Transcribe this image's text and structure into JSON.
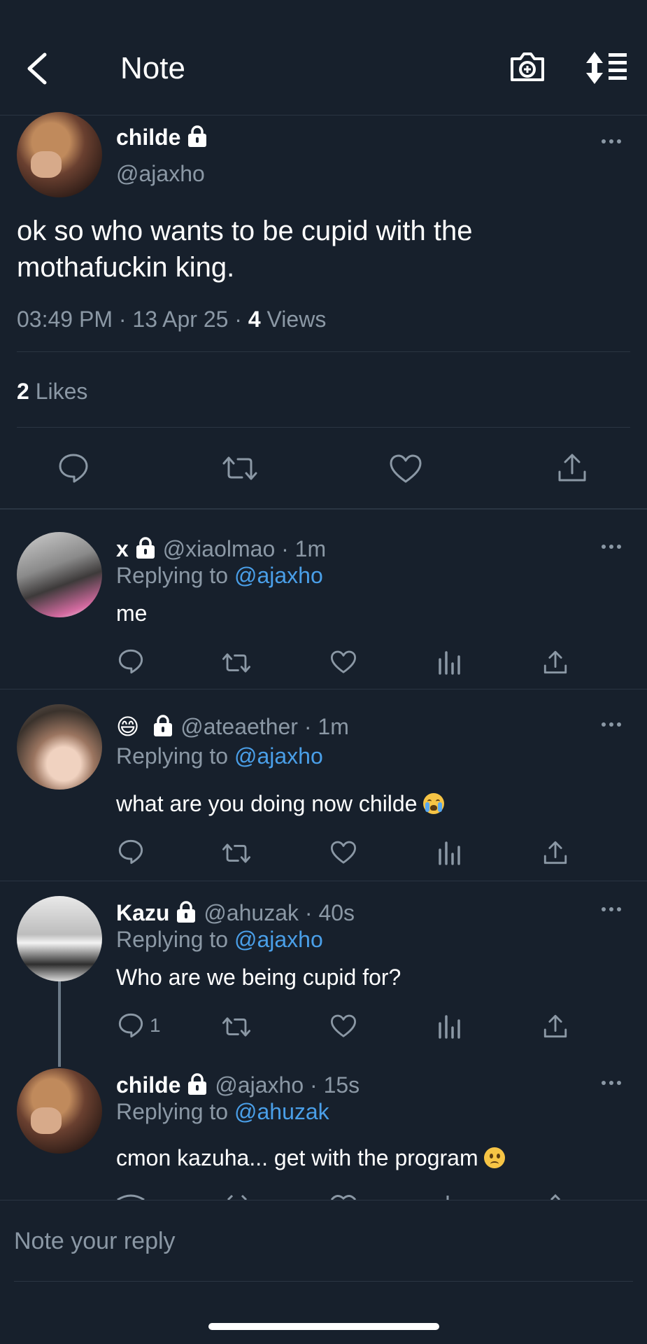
{
  "header": {
    "title": "Note"
  },
  "main_note": {
    "display_name": "childe",
    "handle": "@ajaxho",
    "text": "ok so who wants to be cupid with the mothafuckin king.",
    "time": "03:49 PM",
    "date": "13 Apr 25",
    "views_count": "4",
    "views_label": "Views",
    "likes_count": "2",
    "likes_label": "Likes"
  },
  "replies": [
    {
      "display_name": "x",
      "handle": "@xiaolmao",
      "time": "1m",
      "replying_prefix": "Replying to",
      "replying_handle": "@ajaxho",
      "text": "me"
    },
    {
      "display_name": "😄",
      "handle": "@ateaether",
      "time": "1m",
      "replying_prefix": "Replying to",
      "replying_handle": "@ajaxho",
      "text": "what are you doing now childe"
    },
    {
      "display_name": "Kazu",
      "handle": "@ahuzak",
      "time": "40s",
      "replying_prefix": "Replying to",
      "replying_handle": "@ajaxho",
      "text": "Who are we being cupid for?",
      "reply_count": "1"
    },
    {
      "display_name": "childe",
      "handle": "@ajaxho",
      "time": "15s",
      "replying_prefix": "Replying to",
      "replying_handle": "@ahuzak",
      "text": "cmon kazuha... get with the program"
    }
  ],
  "separator": "·",
  "composer": {
    "placeholder": "Note your reply"
  },
  "colors": {
    "background": "#17202c",
    "accent": "#4a9fe8",
    "muted": "#8b98a5",
    "divider": "#2a3542"
  }
}
